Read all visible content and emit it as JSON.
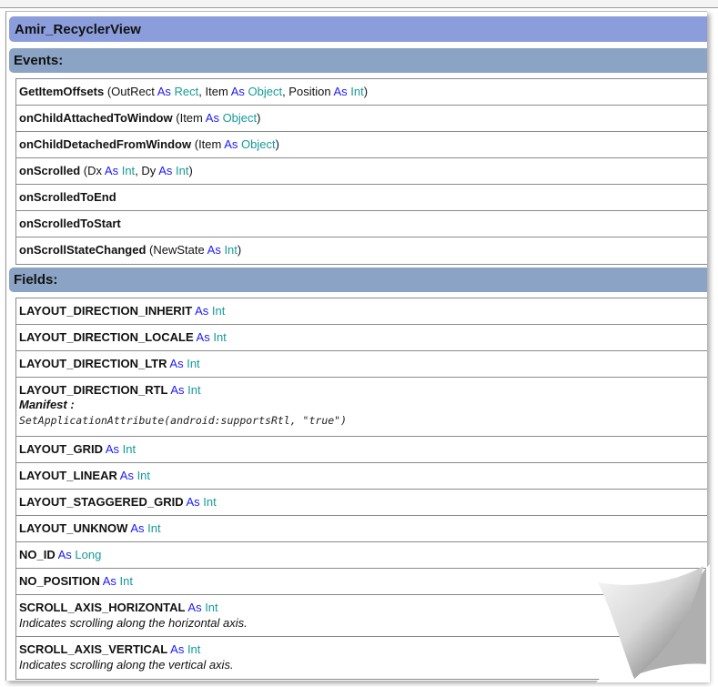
{
  "title": "Amir_RecyclerView",
  "events_heading": "Events:",
  "fields_heading": "Fields:",
  "events": [
    {
      "name": "GetItemOffsets",
      "params": [
        [
          "OutRect",
          "Rect"
        ],
        [
          "Item",
          "Object"
        ],
        [
          "Position",
          "Int"
        ]
      ]
    },
    {
      "name": "onChildAttachedToWindow",
      "params": [
        [
          "Item",
          "Object"
        ]
      ]
    },
    {
      "name": "onChildDetachedFromWindow",
      "params": [
        [
          "Item",
          "Object"
        ]
      ]
    },
    {
      "name": "onScrolled",
      "params": [
        [
          "Dx",
          "Int"
        ],
        [
          "Dy",
          "Int"
        ]
      ]
    },
    {
      "name": "onScrolledToEnd",
      "params": []
    },
    {
      "name": "onScrolledToStart",
      "params": []
    },
    {
      "name": "onScrollStateChanged",
      "params": [
        [
          "NewState",
          "Int"
        ]
      ]
    }
  ],
  "fields": [
    {
      "name": "LAYOUT_DIRECTION_INHERIT",
      "type": "Int"
    },
    {
      "name": "LAYOUT_DIRECTION_LOCALE",
      "type": "Int"
    },
    {
      "name": "LAYOUT_DIRECTION_LTR",
      "type": "Int"
    },
    {
      "name": "LAYOUT_DIRECTION_RTL",
      "type": "Int",
      "manifest_label": "Manifest :",
      "code": "SetApplicationAttribute(android:supportsRtl, \"true\")"
    },
    {
      "name": "LAYOUT_GRID",
      "type": "Int"
    },
    {
      "name": "LAYOUT_LINEAR",
      "type": "Int"
    },
    {
      "name": "LAYOUT_STAGGERED_GRID",
      "type": "Int"
    },
    {
      "name": "LAYOUT_UNKNOW",
      "type": "Int"
    },
    {
      "name": "NO_ID",
      "type": "Long"
    },
    {
      "name": "NO_POSITION",
      "type": "Int"
    },
    {
      "name": "SCROLL_AXIS_HORIZONTAL",
      "type": "Int",
      "description": "Indicates scrolling along the horizontal axis."
    },
    {
      "name": "SCROLL_AXIS_VERTICAL",
      "type": "Int",
      "description": "Indicates scrolling along the vertical axis."
    }
  ],
  "keyword_as": "As",
  "colors": {
    "title_bar": "#8b9edb",
    "section_bar": "#8ba3c4",
    "keyword": "#1a1aff",
    "type": "#159a9a"
  }
}
